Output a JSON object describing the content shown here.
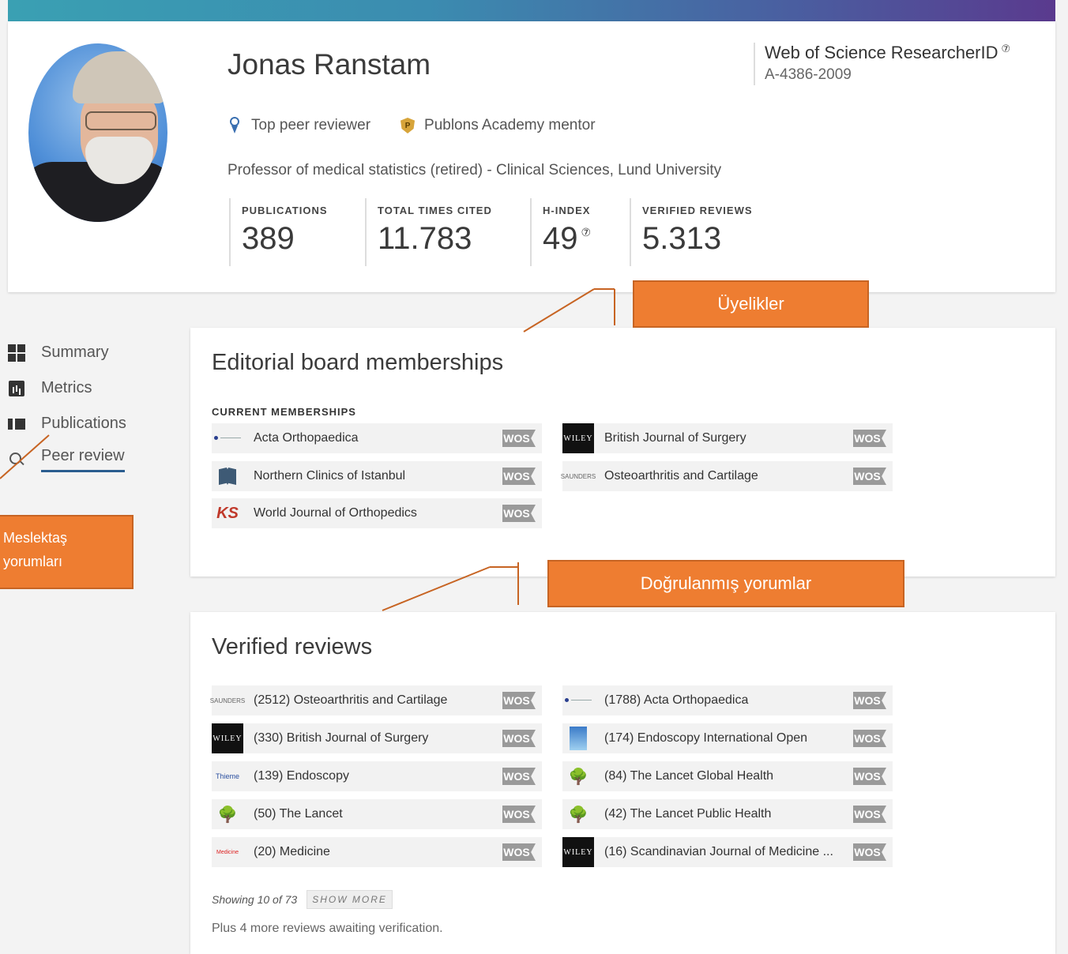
{
  "profile": {
    "name": "Jonas Ranstam",
    "badges": [
      "Top peer reviewer",
      "Publons Academy mentor"
    ],
    "affiliation": "Professor of medical statistics (retired) - Clinical Sciences, Lund University",
    "researcher_id_label": "Web of Science ResearcherID",
    "researcher_id": "A-4386-2009",
    "stats": [
      {
        "label": "PUBLICATIONS",
        "value": "389"
      },
      {
        "label": "TOTAL TIMES CITED",
        "value": "11.783"
      },
      {
        "label": "H-INDEX",
        "value": "49"
      },
      {
        "label": "VERIFIED REVIEWS",
        "value": "5.313"
      }
    ],
    "help_glyph": "⑦"
  },
  "sidebar": {
    "items": [
      {
        "label": "Summary",
        "icon": "summary-icon"
      },
      {
        "label": "Metrics",
        "icon": "metrics-icon"
      },
      {
        "label": "Publications",
        "icon": "publications-icon"
      },
      {
        "label": "Peer review",
        "icon": "search-icon"
      }
    ]
  },
  "editorial": {
    "title": "Editorial board memberships",
    "section": "CURRENT MEMBERSHIPS",
    "journals": [
      {
        "name": "Acta Orthopaedica",
        "badge": "WOS"
      },
      {
        "name": "British Journal of Surgery",
        "badge": "WOS"
      },
      {
        "name": "Northern Clinics of Istanbul",
        "badge": "WOS"
      },
      {
        "name": "Osteoarthritis and Cartilage",
        "badge": "WOS"
      },
      {
        "name": "World Journal of Orthopedics",
        "badge": "WOS"
      }
    ]
  },
  "reviews": {
    "title": "Verified reviews",
    "journals": [
      {
        "name": "(2512) Osteoarthritis and Cartilage",
        "badge": "WOS"
      },
      {
        "name": "(1788) Acta Orthopaedica",
        "badge": "WOS"
      },
      {
        "name": "(330) British Journal of Surgery",
        "badge": "WOS"
      },
      {
        "name": "(174) Endoscopy International Open",
        "badge": "WOS"
      },
      {
        "name": "(139) Endoscopy",
        "badge": "WOS"
      },
      {
        "name": "(84) The Lancet Global Health",
        "badge": "WOS"
      },
      {
        "name": "(50) The Lancet",
        "badge": "WOS"
      },
      {
        "name": "(42) The Lancet Public Health",
        "badge": "WOS"
      },
      {
        "name": "(20) Medicine",
        "badge": "WOS"
      },
      {
        "name": "(16) Scandinavian Journal of Medicine ...",
        "badge": "WOS"
      }
    ],
    "showing": "Showing 10 of 73",
    "show_more": "SHOW MORE",
    "plus": "Plus 4 more reviews awaiting verification."
  },
  "logos": {
    "wiley": "WILEY",
    "saunders": "SAUNDERS",
    "thieme": "Thieme",
    "medicine": "Medicine",
    "ks": "KS",
    "tree": "🌳",
    "publons_p": "P"
  },
  "annotations": {
    "memberships": "Üyelikler",
    "peer_reviews": "Meslektaş yorumları",
    "verified": "Doğrulanmış yorumlar"
  },
  "colors": {
    "annotation": "#ee7d31",
    "wos_badge": "#9a9a9a",
    "active_underline": "#2a5d8f"
  }
}
